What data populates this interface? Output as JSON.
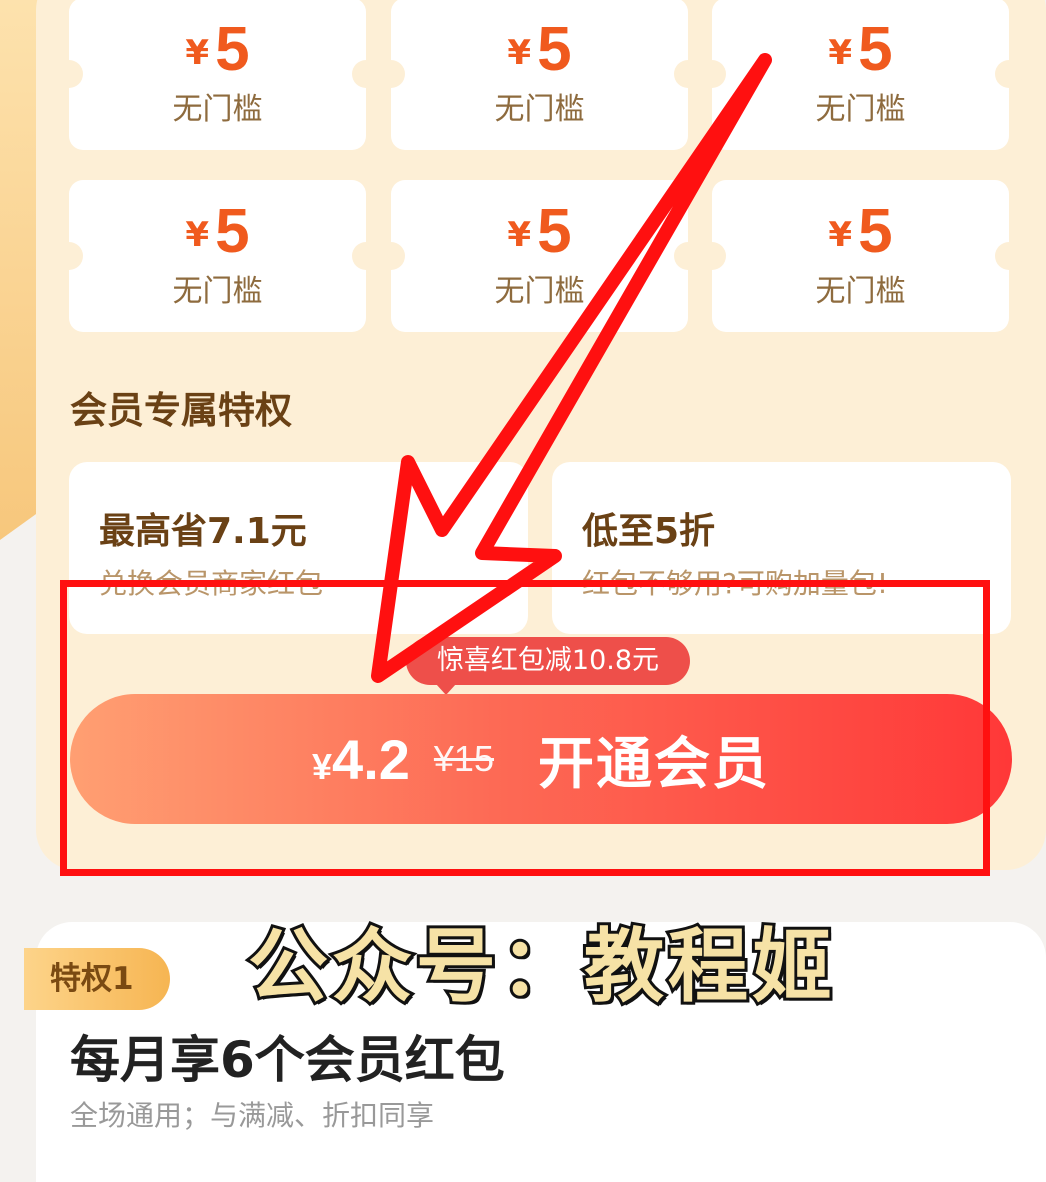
{
  "coupons": [
    {
      "currency": "¥",
      "amount": "5",
      "condition": "无门槛"
    },
    {
      "currency": "¥",
      "amount": "5",
      "condition": "无门槛"
    },
    {
      "currency": "¥",
      "amount": "5",
      "condition": "无门槛"
    },
    {
      "currency": "¥",
      "amount": "5",
      "condition": "无门槛"
    },
    {
      "currency": "¥",
      "amount": "5",
      "condition": "无门槛"
    },
    {
      "currency": "¥",
      "amount": "5",
      "condition": "无门槛"
    }
  ],
  "privileges_section": {
    "title": "会员专属特权",
    "cards": [
      {
        "title": "最高省7.1元",
        "subtitle": "兑换会员商家红包"
      },
      {
        "title": "低至5折",
        "subtitle": "红包不够用?可购加量包!"
      }
    ]
  },
  "promo_bubble": "惊喜红包减10.8元",
  "cta": {
    "currency": "¥",
    "price": "4.2",
    "original_price": "¥15",
    "label": "开通会员"
  },
  "watermark": "公众号：教程姬",
  "privilege_detail": {
    "tag": "特权1",
    "title": "每月享6个会员红包",
    "subtitle": "全场通用；与满减、折扣同享"
  },
  "colors": {
    "accent_orange": "#f05a1e",
    "annotation_red": "#ff1010",
    "panel_bg": "#fdefd6"
  }
}
